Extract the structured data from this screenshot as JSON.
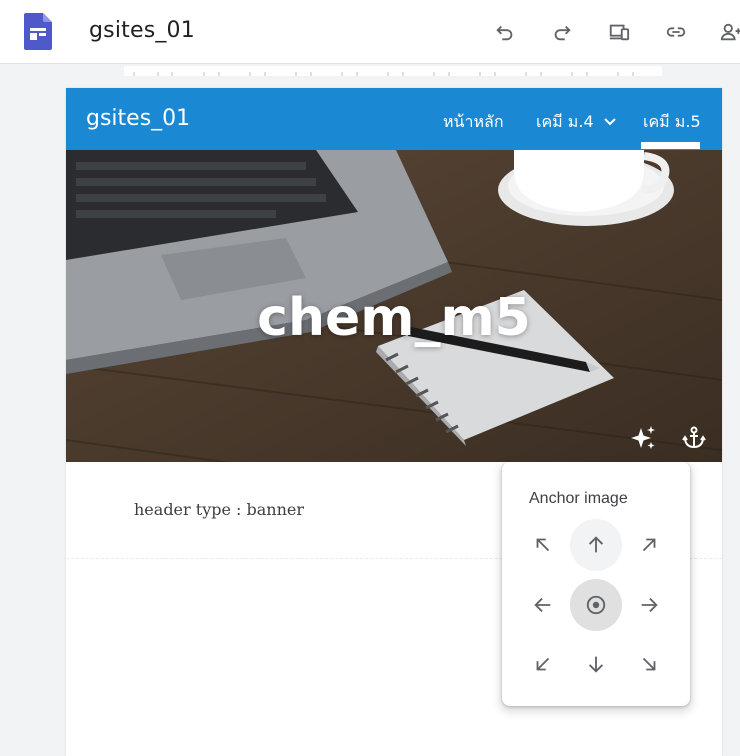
{
  "app": {
    "document_title": "gsites_01",
    "icons": [
      "sites-logo-icon",
      "undo-icon",
      "redo-icon",
      "preview-icon",
      "link-icon",
      "share-icon"
    ]
  },
  "site": {
    "title": "gsites_01",
    "nav": [
      {
        "label": "หน้าหลัก",
        "has_dropdown": false,
        "active": false
      },
      {
        "label": "เคมี ม.4",
        "has_dropdown": true,
        "active": false
      },
      {
        "label": "เคมี ม.5",
        "has_dropdown": false,
        "active": true
      }
    ],
    "header_color": "#1b88d3"
  },
  "banner": {
    "title": "chem_m5",
    "icons": [
      "sparkle-icon",
      "anchor-icon"
    ]
  },
  "body": {
    "header_type_text": "header type : banner"
  },
  "anchor_popup": {
    "title": "Anchor image",
    "options": [
      {
        "name": "top-left",
        "icon": "arrow-up-left-icon"
      },
      {
        "name": "top",
        "icon": "arrow-up-icon",
        "state": "hover"
      },
      {
        "name": "top-right",
        "icon": "arrow-up-right-icon"
      },
      {
        "name": "left",
        "icon": "arrow-left-icon"
      },
      {
        "name": "center",
        "icon": "target-icon",
        "state": "selected"
      },
      {
        "name": "right",
        "icon": "arrow-right-icon"
      },
      {
        "name": "bottom-left",
        "icon": "arrow-down-left-icon"
      },
      {
        "name": "bottom",
        "icon": "arrow-down-icon"
      },
      {
        "name": "bottom-right",
        "icon": "arrow-down-right-icon"
      }
    ]
  }
}
